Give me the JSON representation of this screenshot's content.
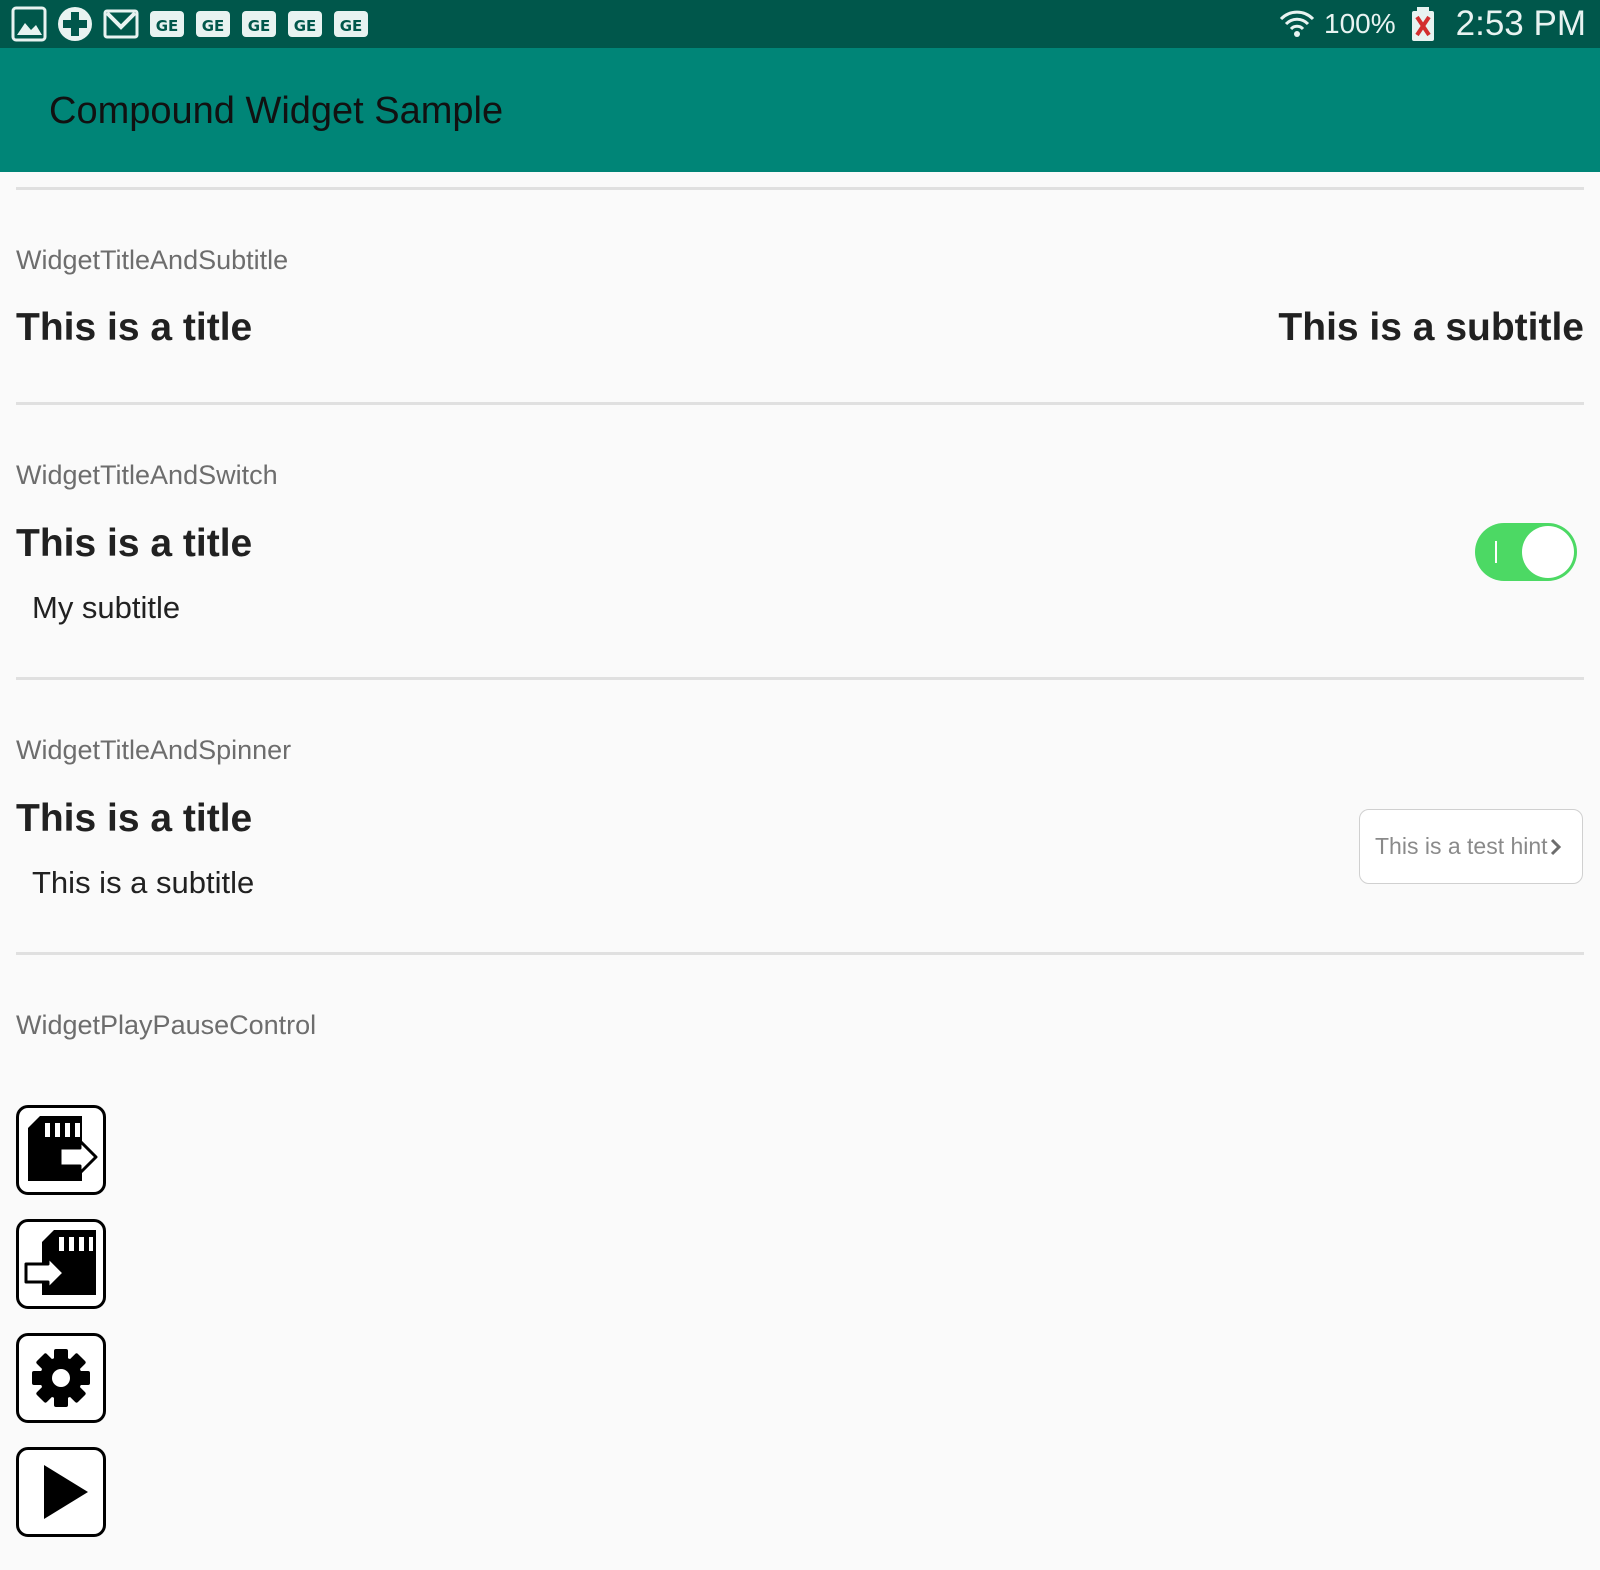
{
  "status_bar": {
    "notification_icons": [
      "gallery-icon",
      "plus-circle-icon",
      "gmail-icon",
      "ge-app-icon",
      "ge-app-icon",
      "ge-app-icon",
      "ge-app-icon",
      "ge-app-icon"
    ],
    "ge_icon_text": "GE",
    "battery_percent": "100%",
    "time": "2:53 PM"
  },
  "app_bar": {
    "title": "Compound Widget Sample"
  },
  "sections": {
    "title_subtitle": {
      "label": "WidgetTitleAndSubtitle",
      "title": "This is a title",
      "subtitle": "This is a subtitle"
    },
    "title_switch": {
      "label": "WidgetTitleAndSwitch",
      "title": "This is a title",
      "subtitle": "My subtitle",
      "switch_on": true
    },
    "title_spinner": {
      "label": "WidgetTitleAndSpinner",
      "title": "This is a title",
      "subtitle": "This is a subtitle",
      "spinner_hint": "This is a test hint"
    },
    "play_pause": {
      "label": "WidgetPlayPauseControl",
      "buttons": [
        "sd-card-eject-icon",
        "sd-card-insert-icon",
        "settings-gear-icon",
        "play-icon"
      ]
    }
  },
  "colors": {
    "status_bar": "#00574b",
    "app_bar": "#008577",
    "switch_on": "#4cd964",
    "background": "#fafafa"
  }
}
